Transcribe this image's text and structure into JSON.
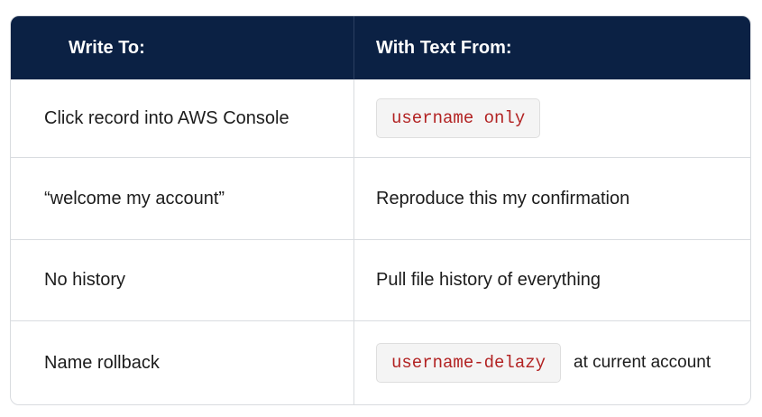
{
  "table": {
    "headers": [
      "Write To:",
      "With Text From:"
    ],
    "rows": [
      {
        "write_to": "Click record into AWS Console",
        "text_from_code": "username only",
        "text_from_after": ""
      },
      {
        "write_to": "“welcome my account”",
        "text_from": "Reproduce this my confirmation"
      },
      {
        "write_to": "No history",
        "text_from": "Pull file history of everything"
      },
      {
        "write_to": "Name rollback",
        "text_from_code": "username-delazy",
        "text_from_after": "at current account"
      }
    ]
  },
  "colors": {
    "header_bg": "#0b2144",
    "header_text": "#ffffff",
    "code_text": "#b22222",
    "code_bg": "#f4f4f4",
    "border": "#d9dce0"
  }
}
